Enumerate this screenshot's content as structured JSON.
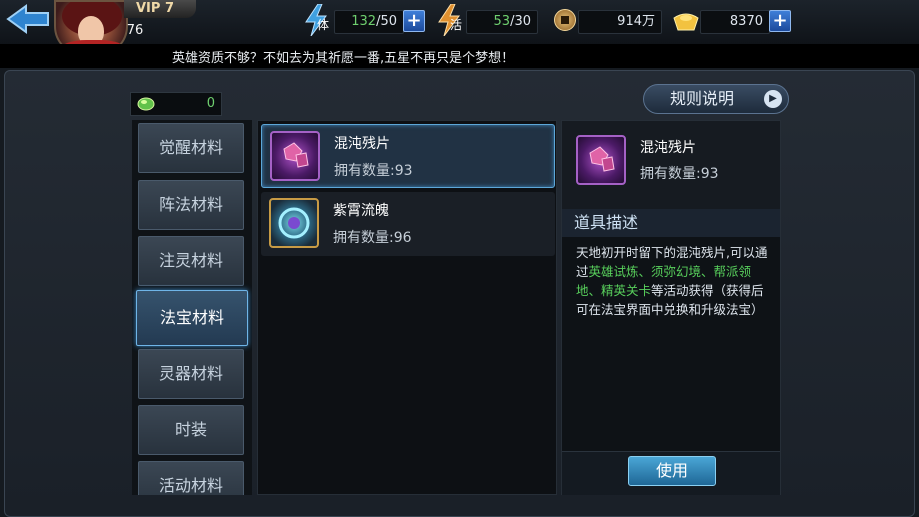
{
  "header": {
    "vip": "VIP 7",
    "level": "76",
    "stamina": {
      "icon": "stamina-lightning-icon",
      "label": "体",
      "value": "132",
      "max": "/50"
    },
    "vigor": {
      "icon": "vigor-lightning-icon",
      "label": "活",
      "value": "53",
      "max": "/30"
    },
    "coins": {
      "icon": "copper-coin-icon",
      "value": "914万"
    },
    "gold": {
      "icon": "gold-ingot-icon",
      "value": "8370"
    },
    "plus": "+",
    "notice": "英雄资质不够？不如去为其祈愿一番,五星不再只是个梦想！"
  },
  "jade": {
    "icon": "jade-icon",
    "value": "0"
  },
  "rules_button": {
    "label": "规则说明",
    "arrow": "▶"
  },
  "tabs": [
    {
      "label": "觉醒材料"
    },
    {
      "label": "阵法材料"
    },
    {
      "label": "注灵材料"
    },
    {
      "label": "法宝材料",
      "active": true
    },
    {
      "label": "灵器材料"
    },
    {
      "label": "时装"
    },
    {
      "label": "活动材料"
    }
  ],
  "items": [
    {
      "name": "混沌残片",
      "count": "拥有数量:93",
      "icon": "chaos-fragment-icon"
    },
    {
      "name": "紫霄流魄",
      "count": "拥有数量:96",
      "icon": "purple-cloud-soul-icon"
    }
  ],
  "detail": {
    "name": "混沌残片",
    "count": "拥有数量:93",
    "desc_title": "道具描述",
    "desc_before": "天地初开时留下的混沌残片,可以通过",
    "desc_highlight": "英雄试炼、须弥幻境、帮派领地、精英关卡",
    "desc_after": "等活动获得（获得后可在法宝界面中兑换和升级法宝）",
    "use_label": "使用"
  },
  "colors": {
    "highlight_green": "#58d05c",
    "selected_border": "#5da7d8",
    "stamina_value": "#6fd06f"
  }
}
